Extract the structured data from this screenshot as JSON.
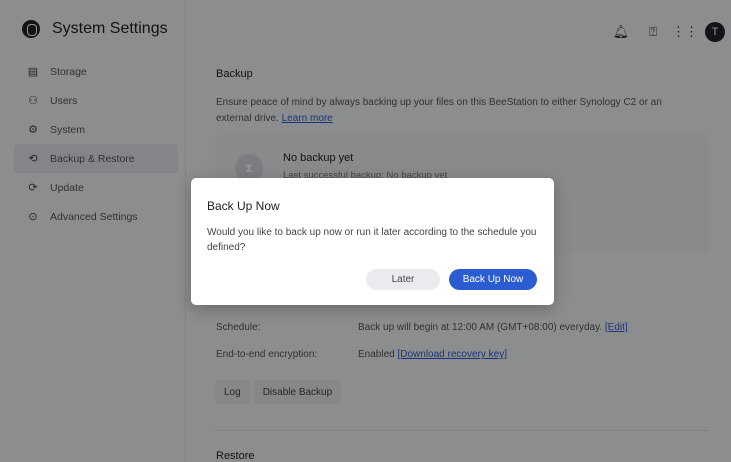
{
  "app": {
    "title": "System Settings"
  },
  "sidebar": {
    "items": [
      {
        "label": "Storage",
        "icon": "storage-icon",
        "glyph": "▤",
        "active": false
      },
      {
        "label": "Users",
        "icon": "user-icon",
        "glyph": "⚇",
        "active": false
      },
      {
        "label": "System",
        "icon": "system-icon",
        "glyph": "⚙",
        "active": false
      },
      {
        "label": "Backup & Restore",
        "icon": "backup-restore-icon",
        "glyph": "⟲",
        "active": true
      },
      {
        "label": "Update",
        "icon": "update-icon",
        "glyph": "⟳",
        "active": false
      },
      {
        "label": "Advanced Settings",
        "icon": "advanced-settings-icon",
        "glyph": "⊙",
        "active": false
      }
    ]
  },
  "topbar": {
    "avatar_letter": "T"
  },
  "backup": {
    "title": "Backup",
    "description": "Ensure peace of mind by always backing up your files on this BeeStation to either Synology C2 or an external drive.",
    "learn_more": "Learn more",
    "status_title": "No backup yet",
    "status_subtitle": "Last successful backup: No backup yet",
    "schedule_label": "Schedule:",
    "schedule_value": "Back up will begin at 12:00 AM (GMT+08:00) everyday.",
    "schedule_edit": "[Edit]",
    "encryption_label": "End-to-end encryption:",
    "encryption_value": "Enabled",
    "encryption_link": "[Download recovery key]",
    "log_button": "Log",
    "disable_button": "Disable Backup"
  },
  "restore": {
    "title": "Restore"
  },
  "dialog": {
    "title": "Back Up Now",
    "body": "Would you like to back up now or run it later according to the schedule you defined?",
    "later_button": "Later",
    "confirm_button": "Back Up Now"
  },
  "colors": {
    "accent": "#2b5cd1",
    "overlay": "rgba(0,0,0,0.42)"
  }
}
